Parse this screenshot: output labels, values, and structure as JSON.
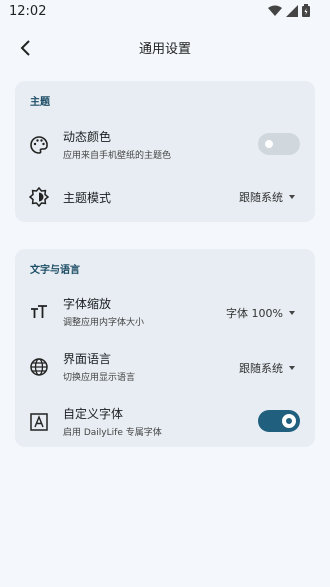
{
  "status": {
    "time": "12:02"
  },
  "appbar": {
    "title": "通用设置"
  },
  "theme": {
    "section_title": "主题",
    "dynamic_color": {
      "title": "动态颜色",
      "subtitle": "应用来自手机壁纸的主题色",
      "enabled": false
    },
    "theme_mode": {
      "title": "主题模式",
      "value": "跟随系统"
    }
  },
  "text_language": {
    "section_title": "文字与语言",
    "font_scale": {
      "title": "字体缩放",
      "subtitle": "调整应用内字体大小",
      "value": "字体 100%"
    },
    "ui_language": {
      "title": "界面语言",
      "subtitle": "切换应用显示语言",
      "value": "跟随系统"
    },
    "custom_font": {
      "title": "自定义字体",
      "subtitle": "启用 DailyLife 专属字体",
      "enabled": true
    }
  },
  "colors": {
    "accent": "#20607e",
    "toggle_off": "#d0d7dd"
  }
}
